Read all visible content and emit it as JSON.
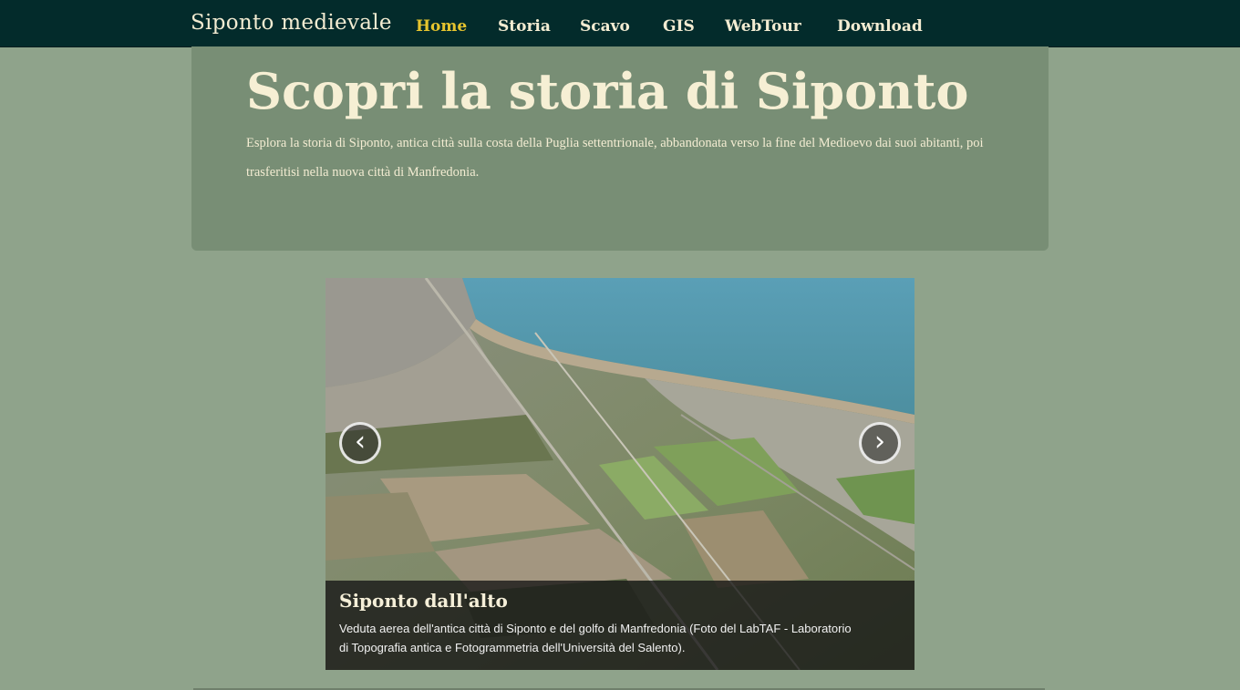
{
  "navbar": {
    "brand": "Siponto medievale",
    "links": [
      {
        "label": "Home",
        "active": true
      },
      {
        "label": "Storia",
        "active": false
      },
      {
        "label": "Scavo",
        "active": false
      },
      {
        "label": "GIS",
        "active": false
      },
      {
        "label": "WebTour",
        "active": false
      },
      {
        "label": "Download",
        "active": false
      }
    ]
  },
  "hero": {
    "title": "Scopri la storia di Siponto",
    "text": "Esplora la storia di Siponto, antica città sulla costa della Puglia settentrionale, abbandonata verso la fine del Medioevo dai suoi abitanti, poi trasferitisi nella nuova città di Manfredonia."
  },
  "carousel": {
    "prev_icon": "chevron-left-icon",
    "next_icon": "chevron-right-icon",
    "prev_glyph": "‹",
    "next_glyph": "›",
    "caption_title": "Siponto dall'alto",
    "caption_text": "Veduta aerea dell'antica città di Siponto e del golfo di Manfredonia (Foto del LabTAF - Laboratorio di Topografia antica e Fotogrammetria dell'Università del Salento)."
  },
  "colors": {
    "navbar_bg": "#032b2b",
    "page_bg": "#8fa38b",
    "hero_bg": "#788e75",
    "active_link": "#e6c42e",
    "text_light": "#f3ecd2"
  }
}
